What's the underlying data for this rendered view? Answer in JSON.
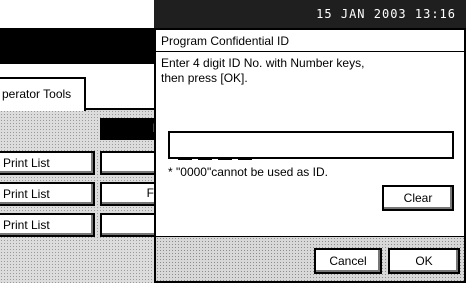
{
  "status_bar": {
    "datetime": "15 JAN 2003 13:16"
  },
  "background": {
    "tab_label": "perator Tools",
    "list_buttons": [
      "Print List",
      "Print List",
      "Print List"
    ],
    "partial_glyphs": [
      "I",
      "F"
    ]
  },
  "dialog": {
    "title": "Program Confidential ID",
    "message": "Enter 4 digit ID No. with Number keys,\nthen press [OK].",
    "note": "* \"0000\"cannot be used as ID.",
    "clear_label": "Clear",
    "cancel_label": "Cancel",
    "ok_label": "OK"
  }
}
